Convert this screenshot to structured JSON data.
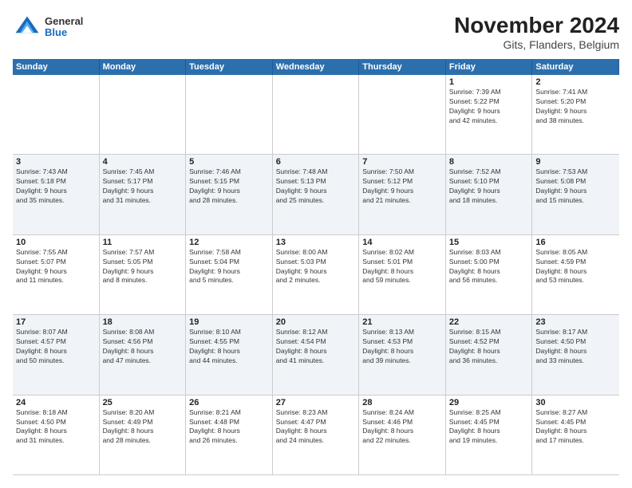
{
  "header": {
    "logo_general": "General",
    "logo_blue": "Blue",
    "title": "November 2024",
    "subtitle": "Gits, Flanders, Belgium"
  },
  "calendar": {
    "days_of_week": [
      "Sunday",
      "Monday",
      "Tuesday",
      "Wednesday",
      "Thursday",
      "Friday",
      "Saturday"
    ],
    "weeks": [
      [
        {
          "day": "",
          "info": ""
        },
        {
          "day": "",
          "info": ""
        },
        {
          "day": "",
          "info": ""
        },
        {
          "day": "",
          "info": ""
        },
        {
          "day": "",
          "info": ""
        },
        {
          "day": "1",
          "info": "Sunrise: 7:39 AM\nSunset: 5:22 PM\nDaylight: 9 hours\nand 42 minutes."
        },
        {
          "day": "2",
          "info": "Sunrise: 7:41 AM\nSunset: 5:20 PM\nDaylight: 9 hours\nand 38 minutes."
        }
      ],
      [
        {
          "day": "3",
          "info": "Sunrise: 7:43 AM\nSunset: 5:18 PM\nDaylight: 9 hours\nand 35 minutes."
        },
        {
          "day": "4",
          "info": "Sunrise: 7:45 AM\nSunset: 5:17 PM\nDaylight: 9 hours\nand 31 minutes."
        },
        {
          "day": "5",
          "info": "Sunrise: 7:46 AM\nSunset: 5:15 PM\nDaylight: 9 hours\nand 28 minutes."
        },
        {
          "day": "6",
          "info": "Sunrise: 7:48 AM\nSunset: 5:13 PM\nDaylight: 9 hours\nand 25 minutes."
        },
        {
          "day": "7",
          "info": "Sunrise: 7:50 AM\nSunset: 5:12 PM\nDaylight: 9 hours\nand 21 minutes."
        },
        {
          "day": "8",
          "info": "Sunrise: 7:52 AM\nSunset: 5:10 PM\nDaylight: 9 hours\nand 18 minutes."
        },
        {
          "day": "9",
          "info": "Sunrise: 7:53 AM\nSunset: 5:08 PM\nDaylight: 9 hours\nand 15 minutes."
        }
      ],
      [
        {
          "day": "10",
          "info": "Sunrise: 7:55 AM\nSunset: 5:07 PM\nDaylight: 9 hours\nand 11 minutes."
        },
        {
          "day": "11",
          "info": "Sunrise: 7:57 AM\nSunset: 5:05 PM\nDaylight: 9 hours\nand 8 minutes."
        },
        {
          "day": "12",
          "info": "Sunrise: 7:58 AM\nSunset: 5:04 PM\nDaylight: 9 hours\nand 5 minutes."
        },
        {
          "day": "13",
          "info": "Sunrise: 8:00 AM\nSunset: 5:03 PM\nDaylight: 9 hours\nand 2 minutes."
        },
        {
          "day": "14",
          "info": "Sunrise: 8:02 AM\nSunset: 5:01 PM\nDaylight: 8 hours\nand 59 minutes."
        },
        {
          "day": "15",
          "info": "Sunrise: 8:03 AM\nSunset: 5:00 PM\nDaylight: 8 hours\nand 56 minutes."
        },
        {
          "day": "16",
          "info": "Sunrise: 8:05 AM\nSunset: 4:59 PM\nDaylight: 8 hours\nand 53 minutes."
        }
      ],
      [
        {
          "day": "17",
          "info": "Sunrise: 8:07 AM\nSunset: 4:57 PM\nDaylight: 8 hours\nand 50 minutes."
        },
        {
          "day": "18",
          "info": "Sunrise: 8:08 AM\nSunset: 4:56 PM\nDaylight: 8 hours\nand 47 minutes."
        },
        {
          "day": "19",
          "info": "Sunrise: 8:10 AM\nSunset: 4:55 PM\nDaylight: 8 hours\nand 44 minutes."
        },
        {
          "day": "20",
          "info": "Sunrise: 8:12 AM\nSunset: 4:54 PM\nDaylight: 8 hours\nand 41 minutes."
        },
        {
          "day": "21",
          "info": "Sunrise: 8:13 AM\nSunset: 4:53 PM\nDaylight: 8 hours\nand 39 minutes."
        },
        {
          "day": "22",
          "info": "Sunrise: 8:15 AM\nSunset: 4:52 PM\nDaylight: 8 hours\nand 36 minutes."
        },
        {
          "day": "23",
          "info": "Sunrise: 8:17 AM\nSunset: 4:50 PM\nDaylight: 8 hours\nand 33 minutes."
        }
      ],
      [
        {
          "day": "24",
          "info": "Sunrise: 8:18 AM\nSunset: 4:50 PM\nDaylight: 8 hours\nand 31 minutes."
        },
        {
          "day": "25",
          "info": "Sunrise: 8:20 AM\nSunset: 4:49 PM\nDaylight: 8 hours\nand 28 minutes."
        },
        {
          "day": "26",
          "info": "Sunrise: 8:21 AM\nSunset: 4:48 PM\nDaylight: 8 hours\nand 26 minutes."
        },
        {
          "day": "27",
          "info": "Sunrise: 8:23 AM\nSunset: 4:47 PM\nDaylight: 8 hours\nand 24 minutes."
        },
        {
          "day": "28",
          "info": "Sunrise: 8:24 AM\nSunset: 4:46 PM\nDaylight: 8 hours\nand 22 minutes."
        },
        {
          "day": "29",
          "info": "Sunrise: 8:25 AM\nSunset: 4:45 PM\nDaylight: 8 hours\nand 19 minutes."
        },
        {
          "day": "30",
          "info": "Sunrise: 8:27 AM\nSunset: 4:45 PM\nDaylight: 8 hours\nand 17 minutes."
        }
      ]
    ]
  }
}
